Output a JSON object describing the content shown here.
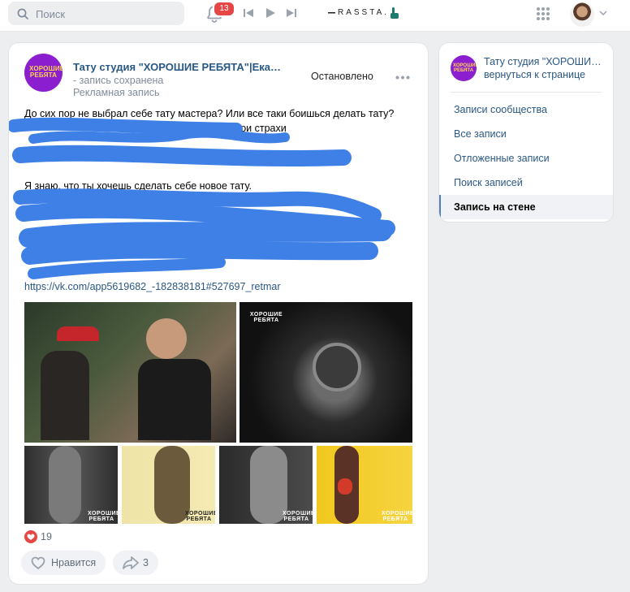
{
  "header": {
    "search_placeholder": "Поиск",
    "notifications_count": "13",
    "music_title": "RASSTA.",
    "icons": [
      "search-icon",
      "bell-icon",
      "previous-track-icon",
      "play-icon",
      "next-track-icon",
      "apps-grid-icon",
      "chevron-down-icon"
    ]
  },
  "post": {
    "author": "Тату студия \"ХОРОШИЕ РЕБЯТА\"|Екатеринбург",
    "saved_note": "- запись сохранена",
    "ad_label": "Рекламная запись",
    "status": "Остановлено",
    "avatar_logo": "ХОРОШИЕ РЕБЯТА",
    "paragraph1_line1": "До сих пор не выбрал себе тату мастера? Или все таки боишься делать тату?",
    "paragraph1_line2_fragment": "твои страхи",
    "paragraph2_line1": "Я знаю, что ты хочешь сделать себе новое тату.",
    "link": "https://vk.com/app5619682_-182838181#527697_retmar",
    "photo_watermark": "ХОРОШИЕ РЕБЯТА",
    "likes": "19",
    "like_label": "Нравится",
    "shares": "3"
  },
  "sidebar": {
    "community_title": "Тату студия \"ХОРОШИЕ РЕБЯТА\"",
    "back_link": "вернуться к странице",
    "items": [
      {
        "label": "Записи сообщества",
        "active": false
      },
      {
        "label": "Все записи",
        "active": false
      },
      {
        "label": "Отложенные записи",
        "active": false
      },
      {
        "label": "Поиск записей",
        "active": false
      },
      {
        "label": "Запись на стене",
        "active": true
      }
    ]
  },
  "colors": {
    "link": "#2a5885",
    "accent": "#5181b8",
    "badge": "#e64646",
    "scribble": "#3f80e6",
    "like": "#e64646"
  }
}
